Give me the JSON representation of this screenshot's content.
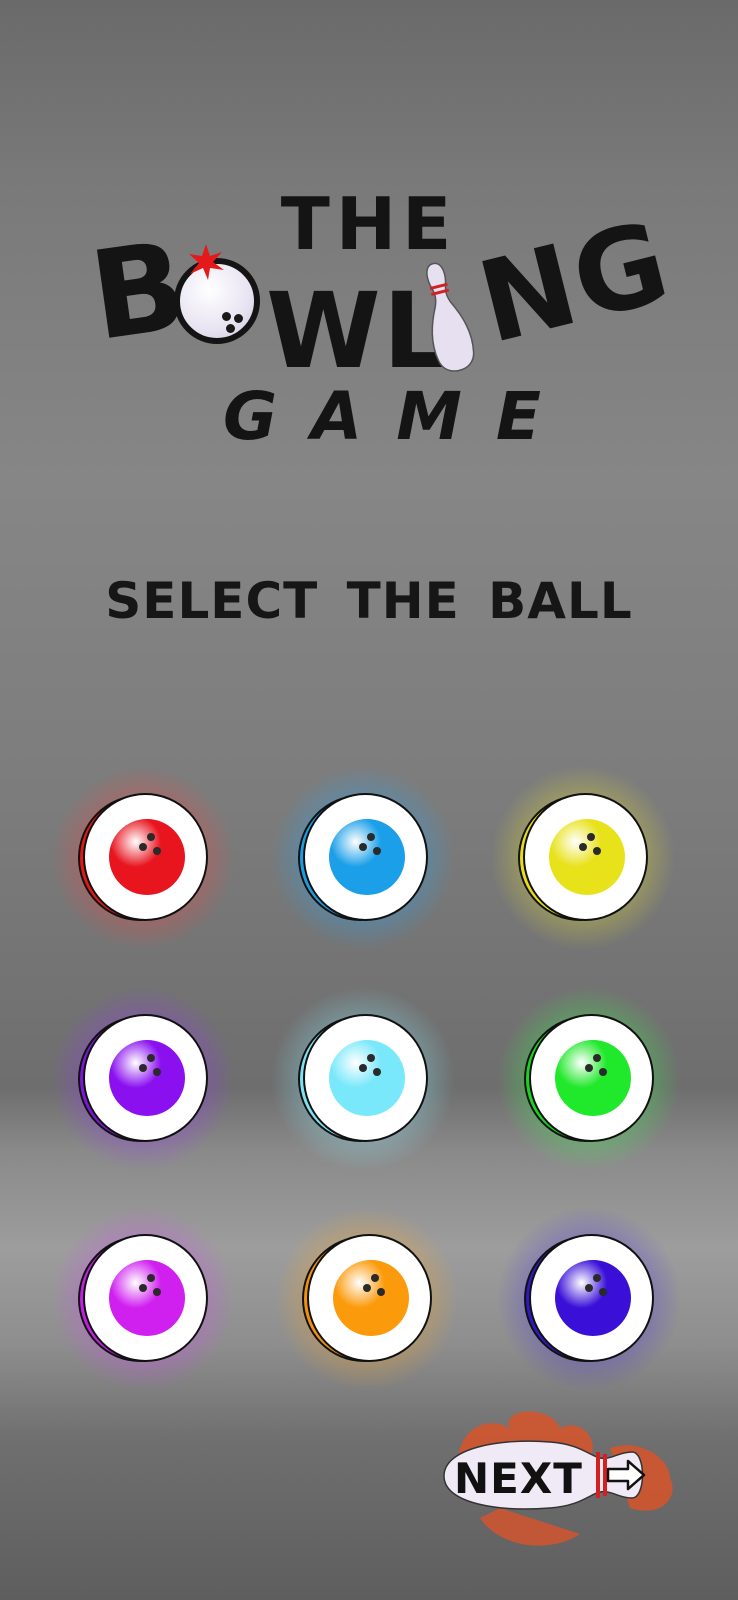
{
  "logo": {
    "line1": "THE",
    "b": "B",
    "wl": "WL",
    "ng": "NG",
    "line3": "GAME",
    "ball_icon": "bowling-ball-icon",
    "pin_icon": "bowling-pin-icon"
  },
  "select_title": "SELECT THE  BALL",
  "balls": [
    {
      "color": "red",
      "fill": "#e8141e",
      "glow": "#ff4040",
      "rim": "#e01818"
    },
    {
      "color": "blue",
      "fill": "#1a9fe8",
      "glow": "#20a8ff",
      "rim": "#1d9be0"
    },
    {
      "color": "yellow",
      "fill": "#e8e21a",
      "glow": "#f0ea20",
      "rim": "#e6dc18"
    },
    {
      "color": "purple",
      "fill": "#8a10f0",
      "glow": "#9a30ff",
      "rim": "#7a18d8"
    },
    {
      "color": "light-blue",
      "fill": "#78e8fa",
      "glow": "#8aeeff",
      "rim": "#7fe0f0"
    },
    {
      "color": "green",
      "fill": "#20e82a",
      "glow": "#30ff40",
      "rim": "#18d420"
    },
    {
      "color": "magenta",
      "fill": "#d020f0",
      "glow": "#d848ff",
      "rim": "#c020e0"
    },
    {
      "color": "orange",
      "fill": "#fb9a0a",
      "glow": "#ffa820",
      "rim": "#f09010"
    },
    {
      "color": "indigo",
      "fill": "#3a10d8",
      "glow": "#4a30e8",
      "rim": "#2e18c0"
    }
  ],
  "next_button": {
    "label": "NEXT",
    "icon": "arrow-right-icon"
  }
}
